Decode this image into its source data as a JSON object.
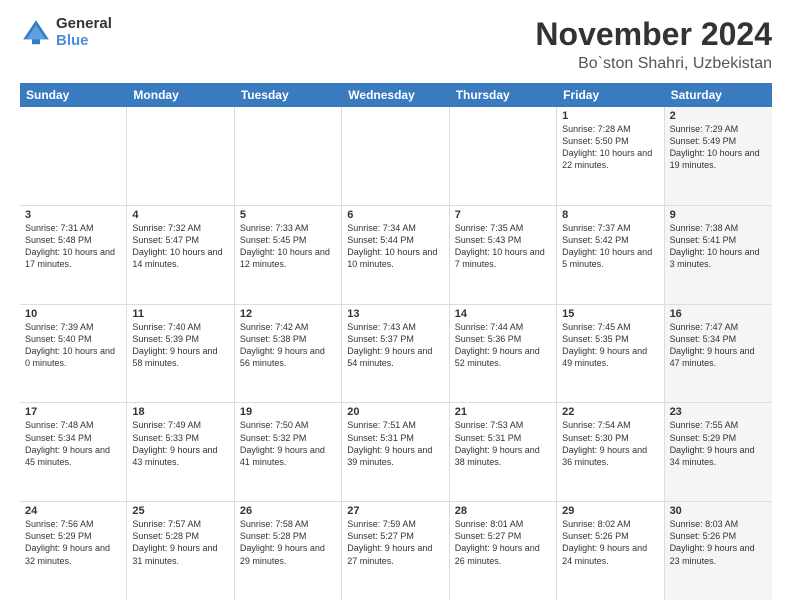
{
  "logo": {
    "general": "General",
    "blue": "Blue"
  },
  "title": "November 2024",
  "location": "Bo`ston Shahri, Uzbekistan",
  "header_days": [
    "Sunday",
    "Monday",
    "Tuesday",
    "Wednesday",
    "Thursday",
    "Friday",
    "Saturday"
  ],
  "weeks": [
    [
      {
        "day": "",
        "info": "",
        "shaded": false,
        "empty": true
      },
      {
        "day": "",
        "info": "",
        "shaded": false,
        "empty": true
      },
      {
        "day": "",
        "info": "",
        "shaded": false,
        "empty": true
      },
      {
        "day": "",
        "info": "",
        "shaded": false,
        "empty": true
      },
      {
        "day": "",
        "info": "",
        "shaded": false,
        "empty": true
      },
      {
        "day": "1",
        "info": "Sunrise: 7:28 AM\nSunset: 5:50 PM\nDaylight: 10 hours\nand 22 minutes.",
        "shaded": false
      },
      {
        "day": "2",
        "info": "Sunrise: 7:29 AM\nSunset: 5:49 PM\nDaylight: 10 hours\nand 19 minutes.",
        "shaded": true
      }
    ],
    [
      {
        "day": "3",
        "info": "Sunrise: 7:31 AM\nSunset: 5:48 PM\nDaylight: 10 hours\nand 17 minutes.",
        "shaded": false
      },
      {
        "day": "4",
        "info": "Sunrise: 7:32 AM\nSunset: 5:47 PM\nDaylight: 10 hours\nand 14 minutes.",
        "shaded": false
      },
      {
        "day": "5",
        "info": "Sunrise: 7:33 AM\nSunset: 5:45 PM\nDaylight: 10 hours\nand 12 minutes.",
        "shaded": false
      },
      {
        "day": "6",
        "info": "Sunrise: 7:34 AM\nSunset: 5:44 PM\nDaylight: 10 hours\nand 10 minutes.",
        "shaded": false
      },
      {
        "day": "7",
        "info": "Sunrise: 7:35 AM\nSunset: 5:43 PM\nDaylight: 10 hours\nand 7 minutes.",
        "shaded": false
      },
      {
        "day": "8",
        "info": "Sunrise: 7:37 AM\nSunset: 5:42 PM\nDaylight: 10 hours\nand 5 minutes.",
        "shaded": false
      },
      {
        "day": "9",
        "info": "Sunrise: 7:38 AM\nSunset: 5:41 PM\nDaylight: 10 hours\nand 3 minutes.",
        "shaded": true
      }
    ],
    [
      {
        "day": "10",
        "info": "Sunrise: 7:39 AM\nSunset: 5:40 PM\nDaylight: 10 hours\nand 0 minutes.",
        "shaded": false
      },
      {
        "day": "11",
        "info": "Sunrise: 7:40 AM\nSunset: 5:39 PM\nDaylight: 9 hours\nand 58 minutes.",
        "shaded": false
      },
      {
        "day": "12",
        "info": "Sunrise: 7:42 AM\nSunset: 5:38 PM\nDaylight: 9 hours\nand 56 minutes.",
        "shaded": false
      },
      {
        "day": "13",
        "info": "Sunrise: 7:43 AM\nSunset: 5:37 PM\nDaylight: 9 hours\nand 54 minutes.",
        "shaded": false
      },
      {
        "day": "14",
        "info": "Sunrise: 7:44 AM\nSunset: 5:36 PM\nDaylight: 9 hours\nand 52 minutes.",
        "shaded": false
      },
      {
        "day": "15",
        "info": "Sunrise: 7:45 AM\nSunset: 5:35 PM\nDaylight: 9 hours\nand 49 minutes.",
        "shaded": false
      },
      {
        "day": "16",
        "info": "Sunrise: 7:47 AM\nSunset: 5:34 PM\nDaylight: 9 hours\nand 47 minutes.",
        "shaded": true
      }
    ],
    [
      {
        "day": "17",
        "info": "Sunrise: 7:48 AM\nSunset: 5:34 PM\nDaylight: 9 hours\nand 45 minutes.",
        "shaded": false
      },
      {
        "day": "18",
        "info": "Sunrise: 7:49 AM\nSunset: 5:33 PM\nDaylight: 9 hours\nand 43 minutes.",
        "shaded": false
      },
      {
        "day": "19",
        "info": "Sunrise: 7:50 AM\nSunset: 5:32 PM\nDaylight: 9 hours\nand 41 minutes.",
        "shaded": false
      },
      {
        "day": "20",
        "info": "Sunrise: 7:51 AM\nSunset: 5:31 PM\nDaylight: 9 hours\nand 39 minutes.",
        "shaded": false
      },
      {
        "day": "21",
        "info": "Sunrise: 7:53 AM\nSunset: 5:31 PM\nDaylight: 9 hours\nand 38 minutes.",
        "shaded": false
      },
      {
        "day": "22",
        "info": "Sunrise: 7:54 AM\nSunset: 5:30 PM\nDaylight: 9 hours\nand 36 minutes.",
        "shaded": false
      },
      {
        "day": "23",
        "info": "Sunrise: 7:55 AM\nSunset: 5:29 PM\nDaylight: 9 hours\nand 34 minutes.",
        "shaded": true
      }
    ],
    [
      {
        "day": "24",
        "info": "Sunrise: 7:56 AM\nSunset: 5:29 PM\nDaylight: 9 hours\nand 32 minutes.",
        "shaded": false
      },
      {
        "day": "25",
        "info": "Sunrise: 7:57 AM\nSunset: 5:28 PM\nDaylight: 9 hours\nand 31 minutes.",
        "shaded": false
      },
      {
        "day": "26",
        "info": "Sunrise: 7:58 AM\nSunset: 5:28 PM\nDaylight: 9 hours\nand 29 minutes.",
        "shaded": false
      },
      {
        "day": "27",
        "info": "Sunrise: 7:59 AM\nSunset: 5:27 PM\nDaylight: 9 hours\nand 27 minutes.",
        "shaded": false
      },
      {
        "day": "28",
        "info": "Sunrise: 8:01 AM\nSunset: 5:27 PM\nDaylight: 9 hours\nand 26 minutes.",
        "shaded": false
      },
      {
        "day": "29",
        "info": "Sunrise: 8:02 AM\nSunset: 5:26 PM\nDaylight: 9 hours\nand 24 minutes.",
        "shaded": false
      },
      {
        "day": "30",
        "info": "Sunrise: 8:03 AM\nSunset: 5:26 PM\nDaylight: 9 hours\nand 23 minutes.",
        "shaded": true
      }
    ]
  ]
}
